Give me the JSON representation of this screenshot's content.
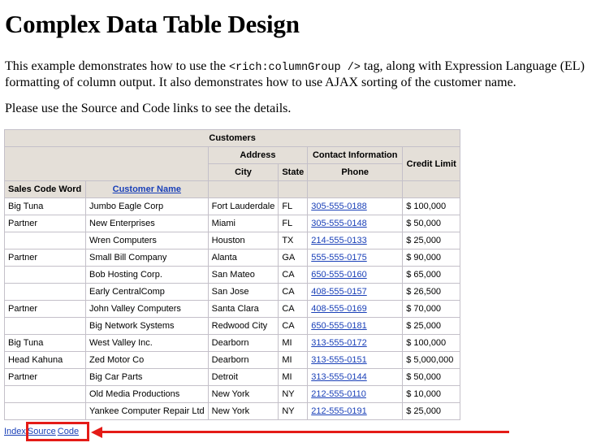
{
  "page": {
    "title": "Complex Data Table Design",
    "intro_before": "This example demonstrates how to use the ",
    "intro_code": "<rich:columnGroup />",
    "intro_after": " tag, along with Expression Language (EL) formatting of column output. It also demonstrates how to use AJAX sorting of the customer name.",
    "note": "Please use the Source and Code links to see the details."
  },
  "table": {
    "caption": "Customers",
    "group_address": "Address",
    "group_contact": "Contact Information",
    "col_credit_limit": "Credit Limit",
    "col_city": "City",
    "col_state": "State",
    "col_phone": "Phone",
    "col_sales_code": "Sales Code Word",
    "col_customer_name": "Customer Name",
    "rows": [
      {
        "code": "Big Tuna",
        "name": "Jumbo Eagle Corp",
        "city": "Fort Lauderdale",
        "state": "FL",
        "phone": "305-555-0188",
        "limit": "$ 100,000"
      },
      {
        "code": "Partner",
        "name": "New Enterprises",
        "city": "Miami",
        "state": "FL",
        "phone": "305-555-0148",
        "limit": "$ 50,000"
      },
      {
        "code": "",
        "name": "Wren Computers",
        "city": "Houston",
        "state": "TX",
        "phone": "214-555-0133",
        "limit": "$ 25,000"
      },
      {
        "code": "Partner",
        "name": "Small Bill Company",
        "city": "Alanta",
        "state": "GA",
        "phone": "555-555-0175",
        "limit": "$ 90,000"
      },
      {
        "code": "",
        "name": "Bob Hosting Corp.",
        "city": "San Mateo",
        "state": "CA",
        "phone": "650-555-0160",
        "limit": "$ 65,000"
      },
      {
        "code": "",
        "name": "Early CentralComp",
        "city": "San Jose",
        "state": "CA",
        "phone": "408-555-0157",
        "limit": "$ 26,500"
      },
      {
        "code": "Partner",
        "name": "John Valley Computers",
        "city": "Santa Clara",
        "state": "CA",
        "phone": "408-555-0169",
        "limit": "$ 70,000"
      },
      {
        "code": "",
        "name": "Big Network Systems",
        "city": "Redwood City",
        "state": "CA",
        "phone": "650-555-0181",
        "limit": "$ 25,000"
      },
      {
        "code": "Big Tuna",
        "name": "West Valley Inc.",
        "city": "Dearborn",
        "state": "MI",
        "phone": "313-555-0172",
        "limit": "$ 100,000"
      },
      {
        "code": "Head Kahuna",
        "name": "Zed Motor Co",
        "city": "Dearborn",
        "state": "MI",
        "phone": "313-555-0151",
        "limit": "$ 5,000,000"
      },
      {
        "code": "Partner",
        "name": "Big Car Parts",
        "city": "Detroit",
        "state": "MI",
        "phone": "313-555-0144",
        "limit": "$ 50,000"
      },
      {
        "code": "",
        "name": "Old Media Productions",
        "city": "New York",
        "state": "NY",
        "phone": "212-555-0110",
        "limit": "$ 10,000"
      },
      {
        "code": "",
        "name": "Yankee Computer Repair Ltd",
        "city": "New York",
        "state": "NY",
        "phone": "212-555-0191",
        "limit": "$ 25,000"
      }
    ]
  },
  "links": {
    "index": "Index",
    "source": "Source",
    "code": "Code"
  },
  "annotation": {
    "color": "#e41b17"
  }
}
